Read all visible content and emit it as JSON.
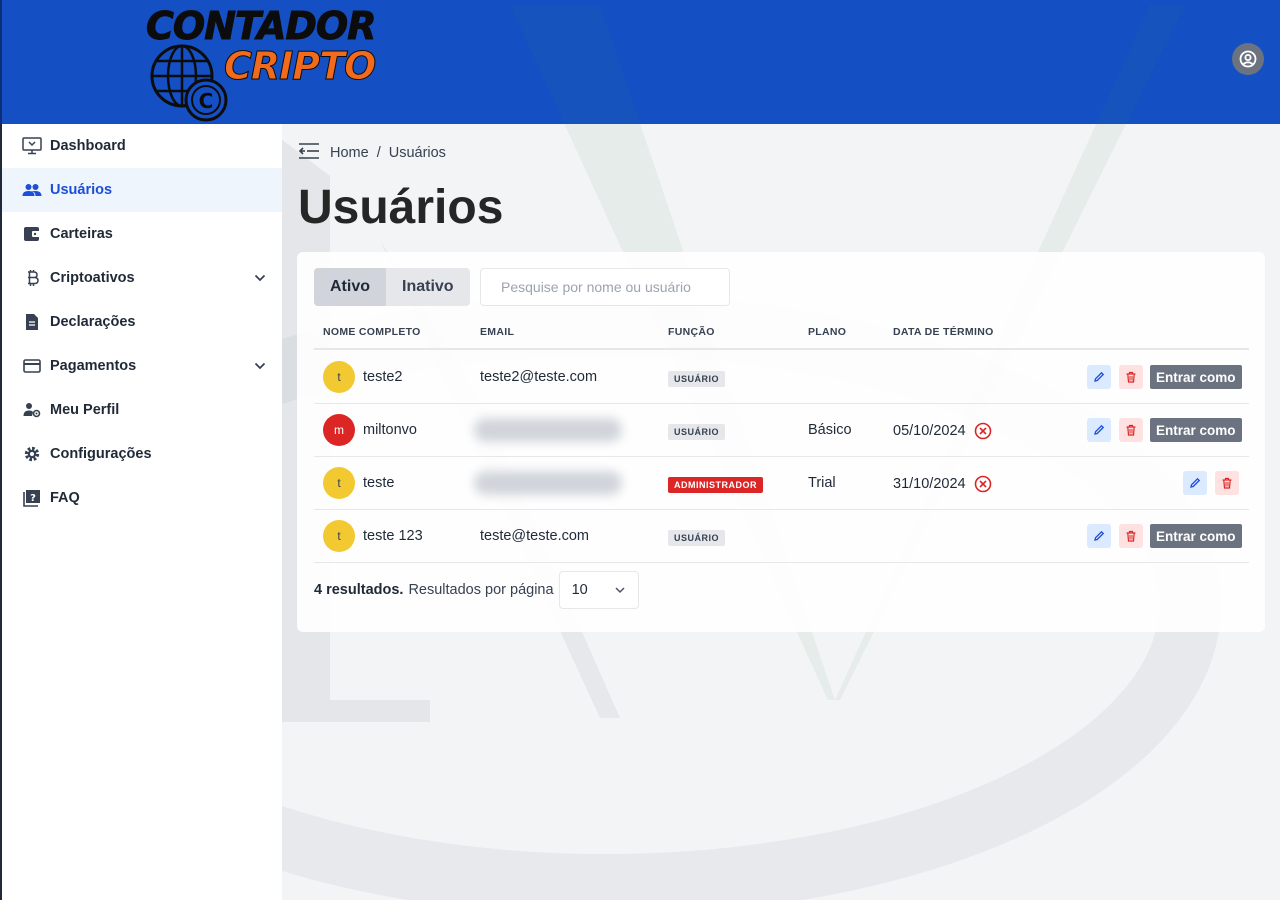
{
  "header": {
    "logo_line1": "CONTADOR",
    "logo_line2": "CRIPTO",
    "logo_badge": "C",
    "brand_color": "#154fc4",
    "logo_accent": "#f26a1b"
  },
  "sidebar": {
    "items": [
      {
        "label": "Dashboard",
        "icon": "monitor-icon",
        "active": false
      },
      {
        "label": "Usuários",
        "icon": "users-icon",
        "active": true
      },
      {
        "label": "Carteiras",
        "icon": "wallet-icon",
        "active": false
      },
      {
        "label": "Criptoativos",
        "icon": "bitcoin-icon",
        "active": false,
        "expandable": true
      },
      {
        "label": "Declarações",
        "icon": "document-icon",
        "active": false
      },
      {
        "label": "Pagamentos",
        "icon": "credit-card-icon",
        "active": false,
        "expandable": true
      },
      {
        "label": "Meu Perfil",
        "icon": "user-gear-icon",
        "active": false
      },
      {
        "label": "Configurações",
        "icon": "gear-icon",
        "active": false
      },
      {
        "label": "FAQ",
        "icon": "question-book-icon",
        "active": false
      }
    ]
  },
  "breadcrumb": {
    "home": "Home",
    "separator": "/",
    "current": "Usuários"
  },
  "page": {
    "title": "Usuários"
  },
  "filters": {
    "tabs": [
      {
        "label": "Ativo",
        "active": true
      },
      {
        "label": "Inativo",
        "active": false
      }
    ],
    "search_placeholder": "Pesquise por nome ou usuário"
  },
  "table": {
    "columns": [
      "NOME COMPLETO",
      "EMAIL",
      "FUNÇÃO",
      "PLANO",
      "DATA DE TÉRMINO"
    ],
    "rows": [
      {
        "initial": "t",
        "avatar_color": "#f3c932",
        "name": "teste2",
        "email": "teste2@teste.com",
        "email_blurred": false,
        "role": "USUÁRIO",
        "plan": "",
        "end_date": "",
        "expired": false,
        "login_as": "Entrar como"
      },
      {
        "initial": "m",
        "avatar_color": "#dc2626",
        "name": "miltonvo",
        "email": "",
        "email_blurred": true,
        "role": "USUÁRIO",
        "plan": "Básico",
        "end_date": "05/10/2024",
        "expired": true,
        "login_as": "Entrar como"
      },
      {
        "initial": "t",
        "avatar_color": "#f3c932",
        "name": "teste",
        "email": "",
        "email_blurred": true,
        "role": "ADMINISTRADOR",
        "plan": "Trial",
        "end_date": "31/10/2024",
        "expired": true,
        "login_as": ""
      },
      {
        "initial": "t",
        "avatar_color": "#f3c932",
        "name": "teste 123",
        "email": "teste@teste.com",
        "email_blurred": false,
        "role": "USUÁRIO",
        "plan": "",
        "end_date": "",
        "expired": false,
        "login_as": "Entrar como"
      }
    ]
  },
  "pagination": {
    "results": "4 resultados.",
    "per_page_label": "Resultados por página",
    "per_page_value": "10"
  }
}
